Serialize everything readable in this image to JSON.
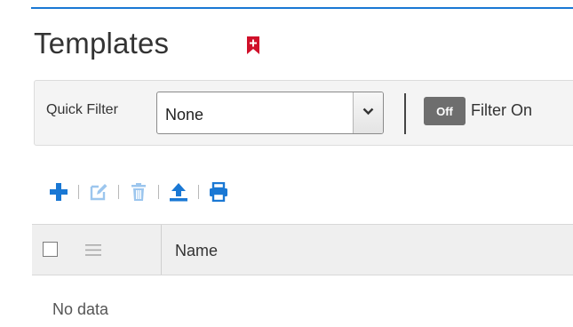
{
  "page": {
    "title": "Templates",
    "accent_color": "#1a78d4",
    "bookmark_color": "#d0102a"
  },
  "quick_filter": {
    "label": "Quick Filter",
    "selected": "None",
    "toggle_state": "Off",
    "toggle_label": "Filter On"
  },
  "toolbar": {
    "items": [
      {
        "name": "add",
        "icon": "plus-icon",
        "enabled": true
      },
      {
        "name": "edit",
        "icon": "edit-icon",
        "enabled": false
      },
      {
        "name": "delete",
        "icon": "trash-icon",
        "enabled": false
      },
      {
        "name": "upload",
        "icon": "upload-icon",
        "enabled": true
      },
      {
        "name": "print",
        "icon": "print-icon",
        "enabled": true
      }
    ]
  },
  "grid": {
    "columns": [
      "Name"
    ],
    "empty_text": "No data"
  }
}
